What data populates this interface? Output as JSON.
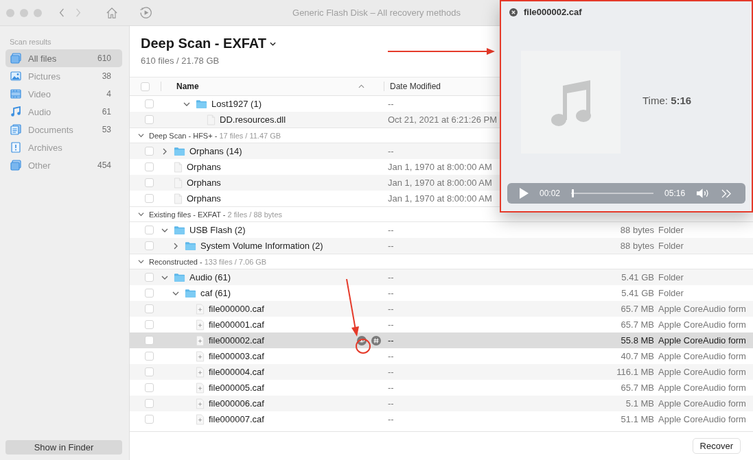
{
  "window": {
    "title": "Generic Flash Disk – All recovery methods"
  },
  "sidebar": {
    "heading": "Scan results",
    "items": [
      {
        "kind": "all",
        "label": "All files",
        "count": "610",
        "selected": true
      },
      {
        "kind": "pictures",
        "label": "Pictures",
        "count": "38",
        "selected": false
      },
      {
        "kind": "video",
        "label": "Video",
        "count": "4",
        "selected": false
      },
      {
        "kind": "audio",
        "label": "Audio",
        "count": "61",
        "selected": false
      },
      {
        "kind": "documents",
        "label": "Documents",
        "count": "53",
        "selected": false
      },
      {
        "kind": "archives",
        "label": "Archives",
        "selected": false
      },
      {
        "kind": "other",
        "label": "Other",
        "count": "454",
        "selected": false
      }
    ],
    "button": "Show in Finder"
  },
  "header": {
    "title": "Deep Scan - EXFAT",
    "subtitle": "610 files / 21.78 GB"
  },
  "table": {
    "select_all": {
      "checked": false
    },
    "columns": [
      {
        "label": "Name",
        "sorted": true
      },
      {
        "label": "Date Modified",
        "sorted": false
      }
    ],
    "sections": [
      {
        "rows": [
          {
            "kind": "folder",
            "name": "Lost1927 (1)",
            "date": "--",
            "checked": false,
            "selected": false,
            "expanded": true,
            "children": [
              {
                "kind": "file",
                "name": "DD.resources.dll",
                "date": "Oct 21, 2021 at 6:21:26 PM",
                "checked": false,
                "selected": false
              }
            ]
          }
        ]
      },
      {
        "title": "Deep Scan - HFS+ -",
        "stats": "17 files / 11.47 GB",
        "expanded": true,
        "rows": [
          {
            "kind": "folder",
            "name": "Orphans (14)",
            "date": "--",
            "checked": false,
            "selected": false,
            "expanded": false
          },
          {
            "kind": "file",
            "name": "Orphans",
            "date": "Jan 1, 1970 at 8:00:00 AM",
            "checked": false,
            "selected": false
          },
          {
            "kind": "file",
            "name": "Orphans",
            "date": "Jan 1, 1970 at 8:00:00 AM",
            "checked": false,
            "selected": false
          },
          {
            "kind": "file",
            "name": "Orphans",
            "date": "Jan 1, 1970 at 8:00:00 AM",
            "checked": false,
            "selected": false
          }
        ]
      },
      {
        "title": "Existing files - EXFAT -",
        "stats": "2 files / 88 bytes",
        "expanded": true,
        "rows": [
          {
            "kind": "folder",
            "name": "USB Flash (2)",
            "date": "--",
            "size": "88 bytes",
            "type": "Folder",
            "checked": false,
            "selected": false,
            "expanded": true,
            "children": [
              {
                "kind": "folder",
                "name": "System Volume Information (2)",
                "date": "--",
                "size": "88 bytes",
                "type": "Folder",
                "checked": false,
                "selected": false,
                "expanded": false
              }
            ]
          }
        ]
      },
      {
        "title": "Reconstructed -",
        "stats": "133 files / 7.06 GB",
        "expanded": true,
        "rows": [
          {
            "kind": "folder",
            "name": "Audio (61)",
            "date": "--",
            "size": "5.41 GB",
            "type": "Folder",
            "checked": false,
            "selected": false,
            "expanded": true,
            "children": [
              {
                "kind": "folder",
                "name": "caf (61)",
                "date": "--",
                "size": "5.41 GB",
                "type": "Folder",
                "checked": false,
                "selected": false,
                "expanded": true,
                "children": [
                  {
                    "kind": "audio",
                    "name": "file000000.caf",
                    "date": "--",
                    "size": "65.7 MB",
                    "type": "Apple CoreAudio form",
                    "checked": false,
                    "selected": false
                  },
                  {
                    "kind": "audio",
                    "name": "file000001.caf",
                    "date": "--",
                    "size": "65.7 MB",
                    "type": "Apple CoreAudio form",
                    "checked": false,
                    "selected": false
                  },
                  {
                    "kind": "audio",
                    "name": "file000002.caf",
                    "date": "--",
                    "size": "55.8 MB",
                    "type": "Apple CoreAudio form",
                    "checked": false,
                    "selected": true
                  },
                  {
                    "kind": "audio",
                    "name": "file000003.caf",
                    "date": "--",
                    "size": "40.7 MB",
                    "type": "Apple CoreAudio form",
                    "checked": false,
                    "selected": false
                  },
                  {
                    "kind": "audio",
                    "name": "file000004.caf",
                    "date": "--",
                    "size": "116.1 MB",
                    "type": "Apple CoreAudio form",
                    "checked": false,
                    "selected": false
                  },
                  {
                    "kind": "audio",
                    "name": "file000005.caf",
                    "date": "--",
                    "size": "65.7 MB",
                    "type": "Apple CoreAudio form",
                    "checked": false,
                    "selected": false
                  },
                  {
                    "kind": "audio",
                    "name": "file000006.caf",
                    "date": "--",
                    "size": "5.1 MB",
                    "type": "Apple CoreAudio form",
                    "checked": false,
                    "selected": false
                  },
                  {
                    "kind": "audio",
                    "name": "file000007.caf",
                    "date": "--",
                    "size": "51.1 MB",
                    "type": "Apple CoreAudio form",
                    "checked": false,
                    "selected": false
                  }
                ]
              }
            ]
          }
        ]
      }
    ]
  },
  "footer": {
    "button": "Recover"
  },
  "preview": {
    "title": "file000002.caf",
    "info": "Time: **5:16**",
    "player": {
      "playing": false,
      "elapsed": "00:02",
      "level": 0.01,
      "duration": "05:16"
    }
  }
}
